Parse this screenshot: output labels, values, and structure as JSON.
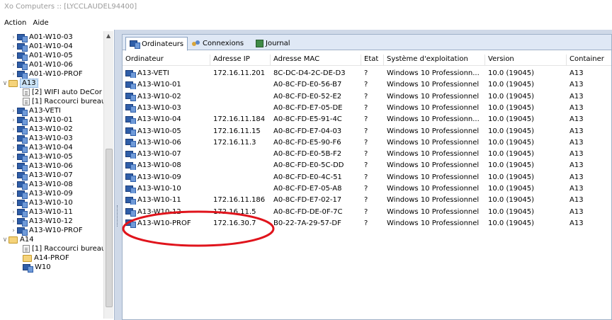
{
  "window": {
    "title": "Xo Computers :: [LYCCLAUDEL94400]"
  },
  "menu": {
    "items": [
      "Action",
      "Aide"
    ]
  },
  "tree": {
    "items": [
      {
        "label": "A01-W10-03",
        "type": "pc",
        "arrow": ">"
      },
      {
        "label": "A01-W10-04",
        "type": "pc",
        "arrow": ">"
      },
      {
        "label": "A01-W10-05",
        "type": "pc",
        "arrow": ">"
      },
      {
        "label": "A01-W10-06",
        "type": "pc",
        "arrow": ">"
      },
      {
        "label": "A01-W10-PROF",
        "type": "pc",
        "arrow": ">"
      },
      {
        "label": "A13",
        "type": "folder",
        "arrow": "v",
        "selected": true
      },
      {
        "label": "[2] WIFI auto DeCor",
        "type": "file",
        "arrow": ""
      },
      {
        "label": "[1] Raccourci bureau",
        "type": "file",
        "arrow": ""
      },
      {
        "label": "A13-VETI",
        "type": "pc",
        "arrow": ">"
      },
      {
        "label": "A13-W10-01",
        "type": "pc",
        "arrow": ">"
      },
      {
        "label": "A13-W10-02",
        "type": "pc",
        "arrow": ">"
      },
      {
        "label": "A13-W10-03",
        "type": "pc",
        "arrow": ">"
      },
      {
        "label": "A13-W10-04",
        "type": "pc",
        "arrow": ">"
      },
      {
        "label": "A13-W10-05",
        "type": "pc",
        "arrow": ">"
      },
      {
        "label": "A13-W10-06",
        "type": "pc",
        "arrow": ">"
      },
      {
        "label": "A13-W10-07",
        "type": "pc",
        "arrow": ">"
      },
      {
        "label": "A13-W10-08",
        "type": "pc",
        "arrow": ">"
      },
      {
        "label": "A13-W10-09",
        "type": "pc",
        "arrow": ">"
      },
      {
        "label": "A13-W10-10",
        "type": "pc",
        "arrow": ">"
      },
      {
        "label": "A13-W10-11",
        "type": "pc",
        "arrow": ">"
      },
      {
        "label": "A13-W10-12",
        "type": "pc",
        "arrow": ">"
      },
      {
        "label": "A13-W10-PROF",
        "type": "pc",
        "arrow": ">"
      },
      {
        "label": "A14",
        "type": "folder",
        "arrow": "v"
      },
      {
        "label": "[1] Raccourci bureau",
        "type": "file",
        "arrow": ""
      },
      {
        "label": "A14-PROF",
        "type": "folder",
        "arrow": ""
      },
      {
        "label": "W10",
        "type": "pc",
        "arrow": ""
      }
    ]
  },
  "tabs": [
    {
      "label": "Ordinateurs",
      "icon": "computers-icon",
      "active": true
    },
    {
      "label": "Connexions",
      "icon": "network-icon",
      "active": false
    },
    {
      "label": "Journal",
      "icon": "journal-icon",
      "active": false
    }
  ],
  "table": {
    "columns": [
      "Ordinateur",
      "Adresse IP",
      "Adresse MAC",
      "Etat",
      "Système d'exploitation",
      "Version",
      "Container"
    ],
    "rows": [
      [
        "A13-VETI",
        "172.16.11.201",
        "8C-DC-D4-2C-DE-D3",
        "?",
        "Windows 10 Professionn...",
        "10.0 (19045)",
        "A13"
      ],
      [
        "A13-W10-01",
        "",
        "A0-8C-FD-E0-56-B7",
        "?",
        "Windows 10 Professionnel",
        "10.0 (19045)",
        "A13"
      ],
      [
        "A13-W10-02",
        "",
        "A0-8C-FD-E0-52-E2",
        "?",
        "Windows 10 Professionnel",
        "10.0 (19045)",
        "A13"
      ],
      [
        "A13-W10-03",
        "",
        "A0-8C-FD-E7-05-DE",
        "?",
        "Windows 10 Professionnel",
        "10.0 (19045)",
        "A13"
      ],
      [
        "A13-W10-04",
        "172.16.11.184",
        "A0-8C-FD-E5-91-4C",
        "?",
        "Windows 10 Professionn...",
        "10.0 (19045)",
        "A13"
      ],
      [
        "A13-W10-05",
        "172.16.11.15",
        "A0-8C-FD-E7-04-03",
        "?",
        "Windows 10 Professionnel",
        "10.0 (19045)",
        "A13"
      ],
      [
        "A13-W10-06",
        "172.16.11.3",
        "A0-8C-FD-E5-90-F6",
        "?",
        "Windows 10 Professionnel",
        "10.0 (19045)",
        "A13"
      ],
      [
        "A13-W10-07",
        "",
        "A0-8C-FD-E0-5B-F2",
        "?",
        "Windows 10 Professionnel",
        "10.0 (19045)",
        "A13"
      ],
      [
        "A13-W10-08",
        "",
        "A0-8C-FD-E0-5C-DD",
        "?",
        "Windows 10 Professionnel",
        "10.0 (19045)",
        "A13"
      ],
      [
        "A13-W10-09",
        "",
        "A0-8C-FD-E0-4C-51",
        "?",
        "Windows 10 Professionnel",
        "10.0 (19045)",
        "A13"
      ],
      [
        "A13-W10-10",
        "",
        "A0-8C-FD-E7-05-A8",
        "?",
        "Windows 10 Professionnel",
        "10.0 (19045)",
        "A13"
      ],
      [
        "A13-W10-11",
        "172.16.11.186",
        "A0-8C-FD-E7-02-17",
        "?",
        "Windows 10 Professionnel",
        "10.0 (19045)",
        "A13"
      ],
      [
        "A13-W10-12",
        "172.16.11.5",
        "A0-8C-FD-DE-0F-7C",
        "?",
        "Windows 10 Professionnel",
        "10.0 (19045)",
        "A13"
      ],
      [
        "A13-W10-PROF",
        "172.16.30.7",
        "B0-22-7A-29-57-DF",
        "?",
        "Windows 10 Professionnel",
        "10.0 (19045)",
        "A13"
      ]
    ]
  },
  "colors": {
    "annotation": "#e0141c",
    "frame": "#cfd9e8",
    "selection": "#cce4f7"
  }
}
